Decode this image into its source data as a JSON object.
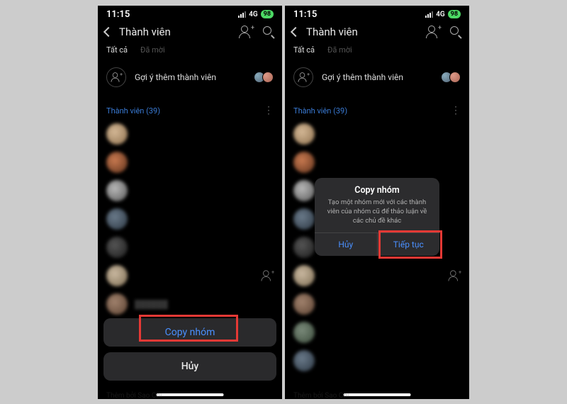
{
  "status": {
    "time": "11:15",
    "network": "4G",
    "battery": "98"
  },
  "header": {
    "title": "Thành viên"
  },
  "tabs": {
    "all": "Tất cả",
    "invited": "Đã mời"
  },
  "suggest": {
    "text": "Gợi ý thêm thành viên"
  },
  "section": {
    "title": "Thành viên (39)"
  },
  "sheet": {
    "copy": "Copy nhóm",
    "cancel": "Hủy"
  },
  "modal": {
    "title": "Copy nhóm",
    "desc": "Tạo một nhóm mới với các thành viên của nhóm cũ để thảo luận về các chủ đề khác",
    "cancel": "Hủy",
    "continue": "Tiếp tục"
  },
  "footer": {
    "hint": "Thêm bởi Sao Chi"
  }
}
